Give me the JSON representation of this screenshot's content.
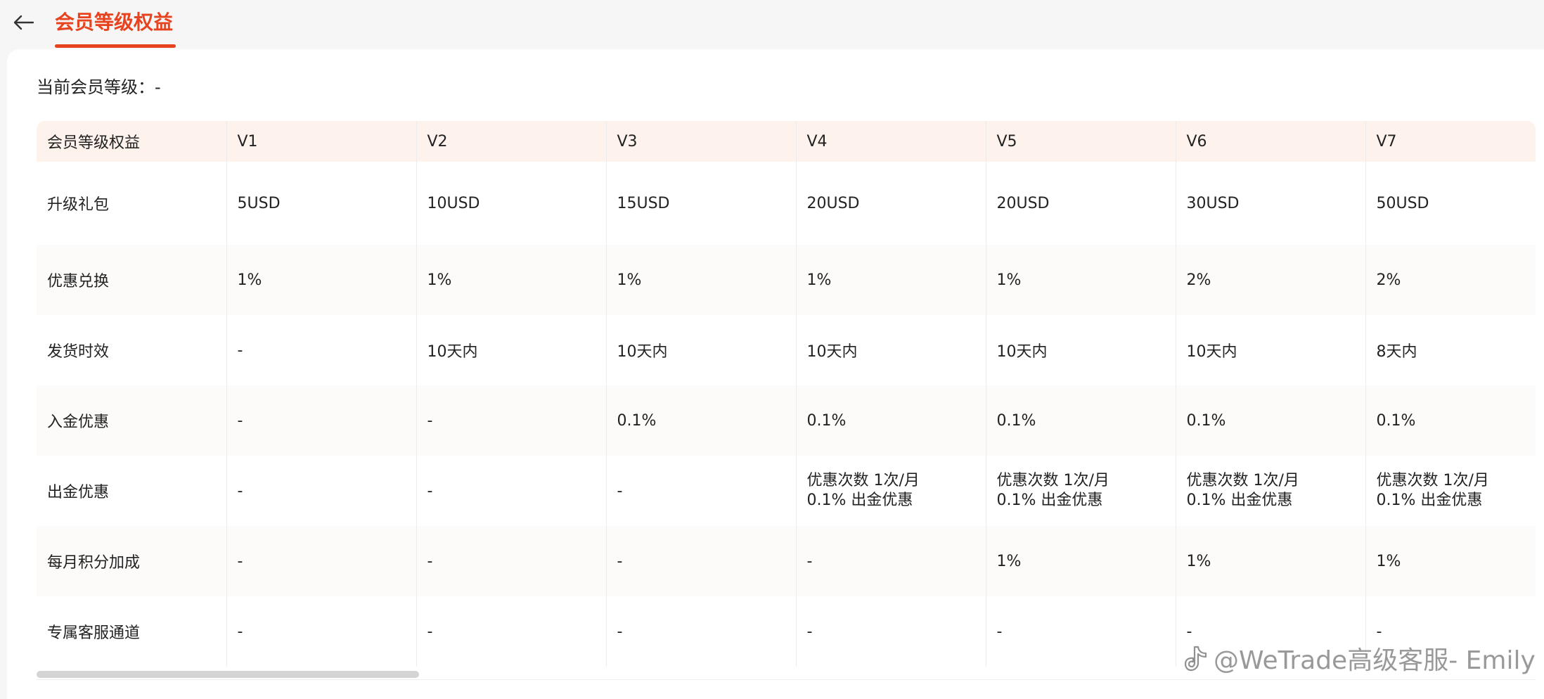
{
  "header": {
    "title": "会员等级权益"
  },
  "current_level": {
    "text": "当前会员等级：-"
  },
  "table": {
    "headers": [
      "会员等级权益",
      "V1",
      "V2",
      "V3",
      "V4",
      "V5",
      "V6",
      "V7"
    ],
    "rows": [
      [
        "升级礼包",
        "5USD",
        "10USD",
        "15USD",
        "20USD",
        "20USD",
        "30USD",
        "50USD"
      ],
      [
        "优惠兑换",
        "1%",
        "1%",
        "1%",
        "1%",
        "1%",
        "2%",
        "2%"
      ],
      [
        "发货时效",
        "-",
        "10天内",
        "10天内",
        "10天内",
        "10天内",
        "10天内",
        "8天内"
      ],
      [
        "入金优惠",
        "-",
        "-",
        "0.1%",
        "0.1%",
        "0.1%",
        "0.1%",
        "0.1%"
      ],
      [
        "出金优惠",
        "-",
        "-",
        "-",
        [
          "优惠次数 1次/月",
          "0.1% 出金优惠"
        ],
        [
          "优惠次数 1次/月",
          "0.1% 出金优惠"
        ],
        [
          "优惠次数 1次/月",
          "0.1% 出金优惠"
        ],
        [
          "优惠次数 1次/月",
          "0.1% 出金优惠"
        ]
      ],
      [
        "每月积分加成",
        "-",
        "-",
        "-",
        "-",
        "1%",
        "1%",
        "1%"
      ],
      [
        "专属客服通道",
        "-",
        "-",
        "-",
        "-",
        "-",
        "-",
        "-"
      ]
    ]
  },
  "watermark": {
    "text": "@WeTrade高级客服- Emily"
  },
  "colors": {
    "accent": "#e8431f",
    "header_row_bg": "#fdf3ec"
  },
  "icons": {
    "back": "arrow-left-icon",
    "watermark": "social-logo-icon"
  }
}
